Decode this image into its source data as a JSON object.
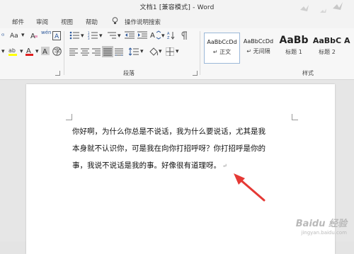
{
  "window": {
    "title": "文档1 [兼容模式] - Word"
  },
  "tabs": [
    "邮件",
    "审阅",
    "视图",
    "帮助"
  ],
  "tell_me": {
    "label": "操作说明搜索"
  },
  "ribbon": {
    "font_size_label": "Aa",
    "styles": [
      {
        "sample": "AaBbCcDd",
        "name": "正文"
      },
      {
        "sample": "AaBbCcDd",
        "name": "无间隔"
      },
      {
        "sample": "AaBb",
        "name": "标题 1"
      },
      {
        "sample": "AaBbC",
        "name": "标题 2"
      },
      {
        "sample": "A",
        "name": ""
      }
    ],
    "groups": {
      "paragraph": "段落",
      "styles": "样式"
    }
  },
  "document": {
    "lines": [
      "你好啊，为什么你总是不说话，我为什么要说话，尤其是我",
      "本身就不认识你，可是我在向你打招呼呀？你打招呼是你的",
      "事，我说不说话是我的事。好像很有道理呀。"
    ],
    "paragraph_mark": "↵"
  },
  "watermark": {
    "brand": "Baidu 经验",
    "url": "jingyan.baidu.com"
  },
  "colors": {
    "arrow": "#e53935",
    "style_selected_border": "#9bb8d8",
    "highlight": "#ffff00",
    "font_color": "#e02020"
  }
}
